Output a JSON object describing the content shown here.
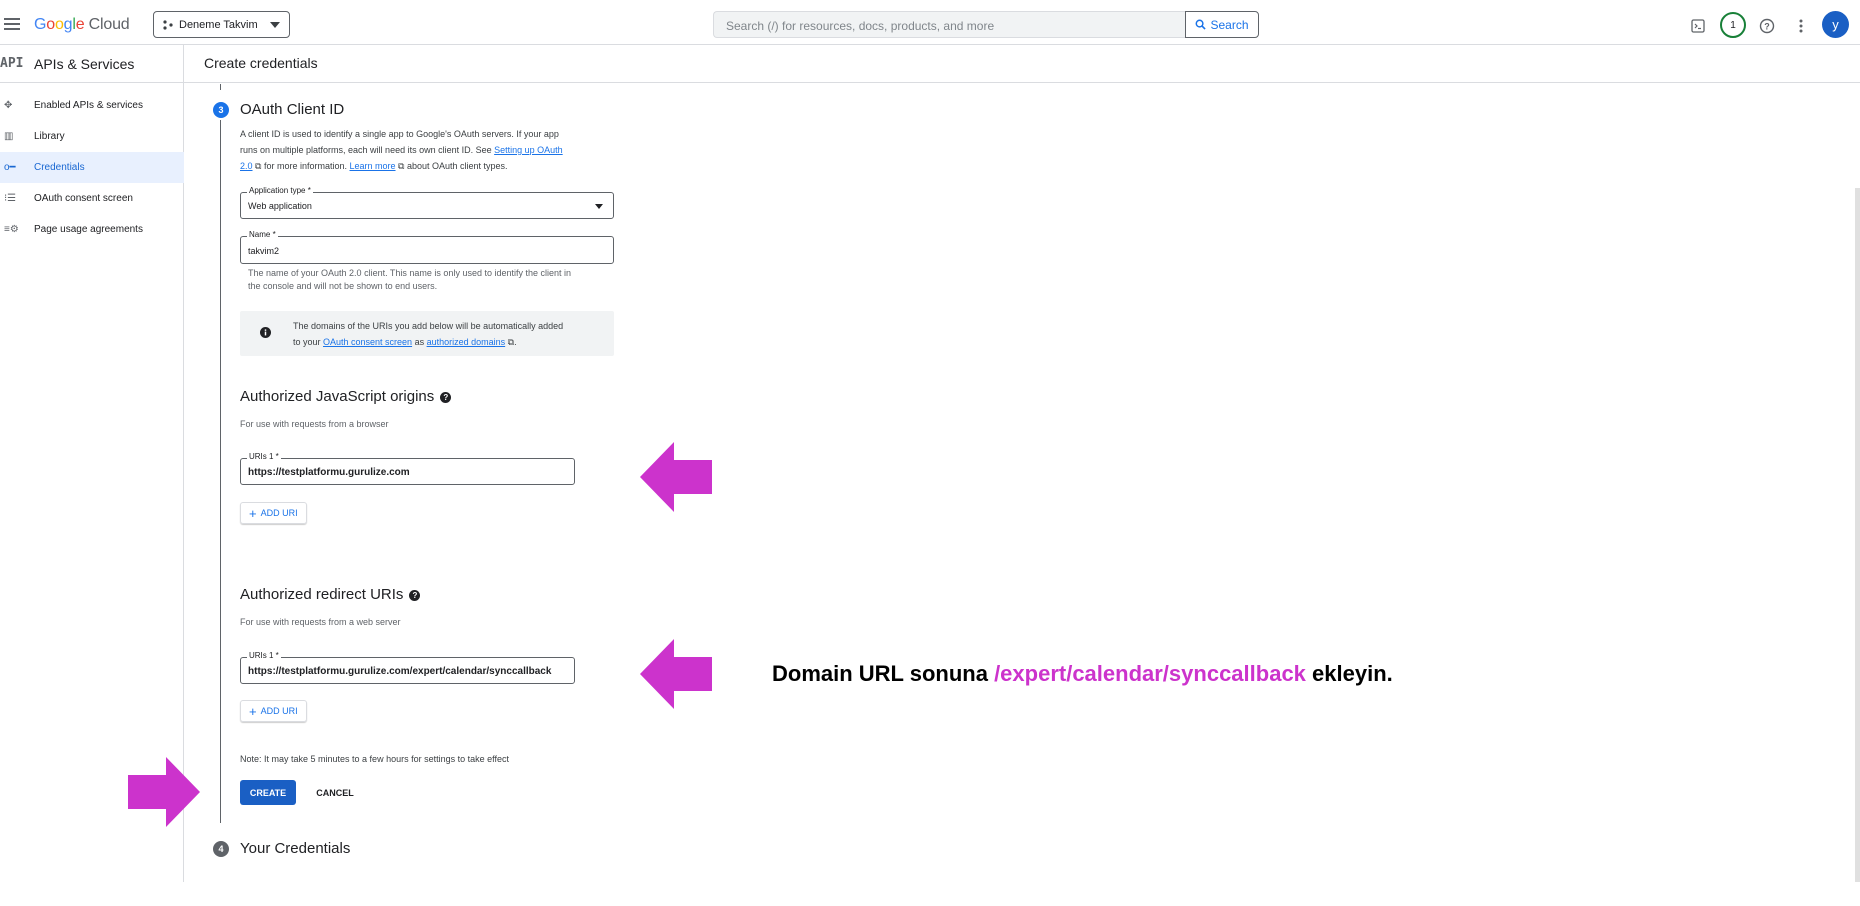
{
  "topbar": {
    "logo_google": "Google",
    "logo_cloud": " Cloud",
    "project_name": "Deneme Takvim",
    "search_placeholder": "Search (/) for resources, docs, products, and more",
    "search_button": "Search",
    "notification_count": "1",
    "avatar_letter": "y"
  },
  "sidebar": {
    "api_badge": "API",
    "title": "APIs & Services",
    "items": [
      {
        "label": "Enabled APIs & services",
        "icon": "services-icon"
      },
      {
        "label": "Library",
        "icon": "library-icon"
      },
      {
        "label": "Credentials",
        "icon": "key-icon",
        "active": true
      },
      {
        "label": "OAuth consent screen",
        "icon": "consent-icon"
      },
      {
        "label": "Page usage agreements",
        "icon": "agreements-icon"
      }
    ]
  },
  "header": {
    "title": "Create credentials"
  },
  "step3": {
    "number": "3",
    "title": "OAuth Client ID",
    "desc_1": "A client ID is used to identify a single app to Google's OAuth servers. If your app",
    "desc_2": "runs on multiple platforms, each will need its own client ID. See ",
    "desc_link1a": "Setting up OAuth",
    "desc_link1b": "2.0",
    "desc_3": " for more information. ",
    "desc_link2": "Learn more",
    "desc_4": " about OAuth client types."
  },
  "app_type": {
    "label": "Application type *",
    "value": "Web application"
  },
  "name_field": {
    "label": "Name *",
    "value": "takvim2",
    "help_1": "The name of your OAuth 2.0 client. This name is only used to identify the client in",
    "help_2": "the console and will not be shown to end users."
  },
  "info": {
    "text_1": "The domains of the URIs you add below will be automatically added",
    "text_2": "to your ",
    "link_1": "OAuth consent screen",
    "text_3": " as ",
    "link_2": "authorized domains",
    "text_4": "."
  },
  "js_origins": {
    "title": "Authorized JavaScript origins",
    "subtitle": "For use with requests from a browser",
    "uri_label": "URIs 1 *",
    "uri_value": "https://testplatformu.gurulize.com",
    "add_button": "ADD URI"
  },
  "redirect_uris": {
    "title": "Authorized redirect URIs",
    "subtitle": "For use with requests from a web server",
    "uri_label": "URIs 1 *",
    "uri_value": "https://testplatformu.gurulize.com/expert/calendar/synccallback",
    "add_button": "ADD URI"
  },
  "note": "Note: It may take 5 minutes to a few hours for settings to take effect",
  "actions": {
    "create": "CREATE",
    "cancel": "CANCEL"
  },
  "step4": {
    "number": "4",
    "title": "Your Credentials"
  },
  "annotation": {
    "part1": "Domain URL sonuna ",
    "highlight": "/expert/calendar/synccallback",
    "part2": " ekleyin."
  },
  "colors": {
    "accent": "#1a73e8",
    "primary_button": "#1a5fc4",
    "arrow": "#cc33cc",
    "active_nav_bg": "#e8f0fe"
  }
}
